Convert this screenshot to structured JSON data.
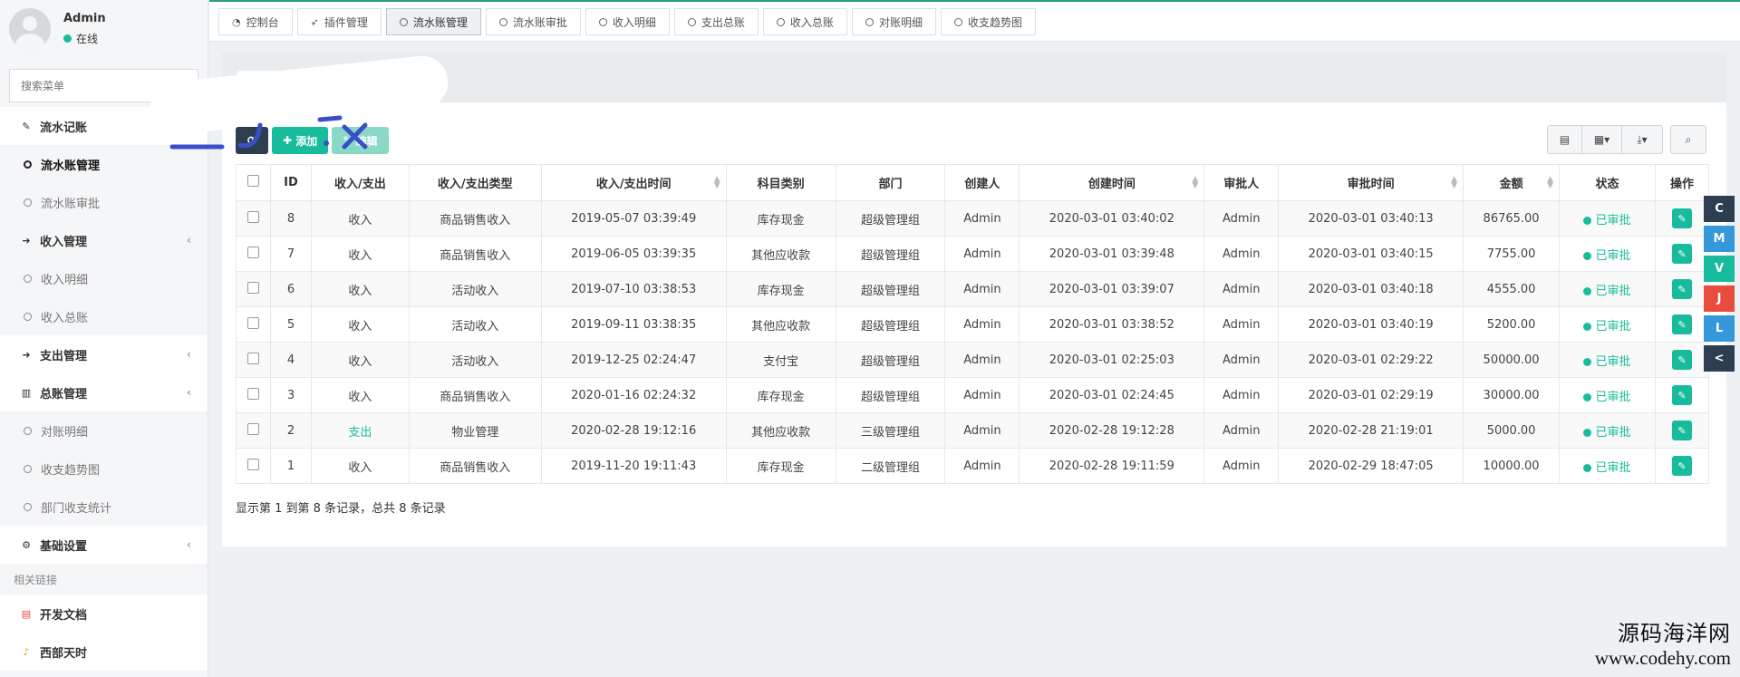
{
  "user": {
    "name": "Admin",
    "status": "在线"
  },
  "search": {
    "placeholder": "搜索菜单"
  },
  "menu": {
    "liushui": "流水记账",
    "liushui_manage": "流水账管理",
    "liushui_approve": "流水账审批",
    "income": "收入管理",
    "income_detail": "收入明细",
    "income_total": "收入总账",
    "expense": "支出管理",
    "ledger": "总账管理",
    "reconcile": "对账明细",
    "trend": "收支趋势图",
    "dept": "部门收支统计",
    "settings": "基础设置",
    "links_label": "相关链接",
    "docs": "开发文档",
    "weather": "西部天时"
  },
  "tabs": [
    "控制台",
    "插件管理",
    "流水账管理",
    "流水账审批",
    "收入明细",
    "支出总账",
    "收入总账",
    "对账明细",
    "收支趋势图"
  ],
  "toolbar": {
    "add": "添加",
    "edit": "编辑"
  },
  "table": {
    "headers": [
      "ID",
      "收入/支出",
      "收入/支出类型",
      "收入/支出时间",
      "科目类别",
      "部门",
      "创建人",
      "创建时间",
      "审批人",
      "审批时间",
      "金额",
      "状态",
      "操作"
    ],
    "rows": [
      [
        "8",
        "收入",
        "商品销售收入",
        "2019-05-07 03:39:49",
        "库存现金",
        "超级管理组",
        "Admin",
        "2020-03-01 03:40:02",
        "Admin",
        "2020-03-01 03:40:13",
        "86765.00",
        "已审批"
      ],
      [
        "7",
        "收入",
        "商品销售收入",
        "2019-06-05 03:39:35",
        "其他应收款",
        "超级管理组",
        "Admin",
        "2020-03-01 03:39:48",
        "Admin",
        "2020-03-01 03:40:15",
        "7755.00",
        "已审批"
      ],
      [
        "6",
        "收入",
        "活动收入",
        "2019-07-10 03:38:53",
        "库存现金",
        "超级管理组",
        "Admin",
        "2020-03-01 03:39:07",
        "Admin",
        "2020-03-01 03:40:18",
        "4555.00",
        "已审批"
      ],
      [
        "5",
        "收入",
        "活动收入",
        "2019-09-11 03:38:35",
        "其他应收款",
        "超级管理组",
        "Admin",
        "2020-03-01 03:38:52",
        "Admin",
        "2020-03-01 03:40:19",
        "5200.00",
        "已审批"
      ],
      [
        "4",
        "收入",
        "活动收入",
        "2019-12-25 02:24:47",
        "支付宝",
        "超级管理组",
        "Admin",
        "2020-03-01 02:25:03",
        "Admin",
        "2020-03-01 02:29:22",
        "50000.00",
        "已审批"
      ],
      [
        "3",
        "收入",
        "商品销售收入",
        "2020-01-16 02:24:32",
        "库存现金",
        "超级管理组",
        "Admin",
        "2020-03-01 02:24:45",
        "Admin",
        "2020-03-01 02:29:19",
        "30000.00",
        "已审批"
      ],
      [
        "2",
        "支出",
        "物业管理",
        "2020-02-28 19:12:16",
        "其他应收款",
        "三级管理组",
        "Admin",
        "2020-02-28 19:12:28",
        "Admin",
        "2020-02-28 21:19:01",
        "5000.00",
        "已审批"
      ],
      [
        "1",
        "收入",
        "商品销售收入",
        "2019-11-20 19:11:43",
        "库存现金",
        "二级管理组",
        "Admin",
        "2020-02-28 19:11:59",
        "Admin",
        "2020-02-29 18:47:05",
        "10000.00",
        "已审批"
      ]
    ]
  },
  "pagination": {
    "summary": "显示第 1 到第 8 条记录，总共 8 条记录"
  },
  "float_buttons": [
    {
      "label": "C",
      "color": "#2c3e50"
    },
    {
      "label": "M",
      "color": "#3498db"
    },
    {
      "label": "V",
      "color": "#18bc9c"
    },
    {
      "label": "J",
      "color": "#e74c3c"
    },
    {
      "label": "L",
      "color": "#3498db"
    },
    {
      "label": "<",
      "color": "#2c3e50"
    }
  ],
  "watermark": {
    "line1": "源码海洋网",
    "line2": "www.codehy.com"
  },
  "colors": {
    "accent": "#18bc9c",
    "dark": "#2c3e50"
  }
}
